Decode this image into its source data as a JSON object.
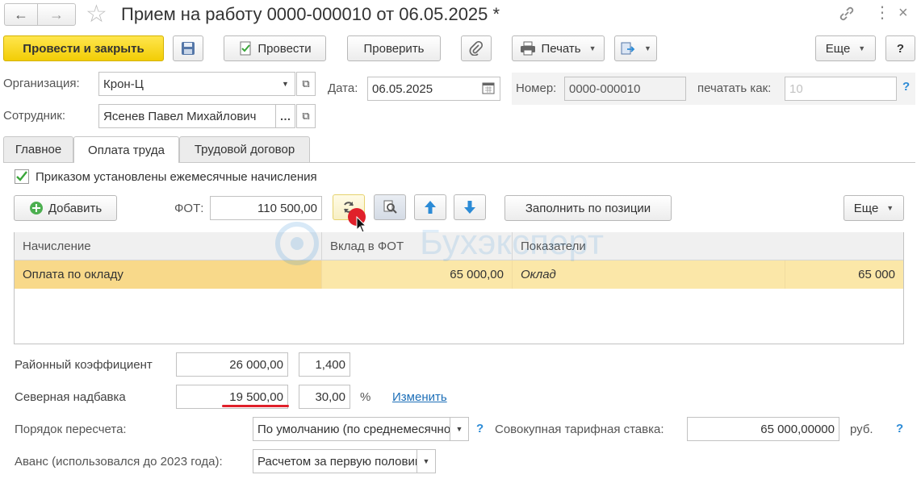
{
  "window": {
    "title": "Прием на работу 0000-000010 от 06.05.2025 *"
  },
  "toolbar": {
    "post_close_label": "Провести и закрыть",
    "post_label": "Провести",
    "check_label": "Проверить",
    "print_label": "Печать",
    "more_label": "Еще",
    "help_label": "?"
  },
  "header": {
    "org_label": "Организация:",
    "org_value": "Крон-Ц",
    "date_label": "Дата:",
    "date_value": "06.05.2025",
    "number_label": "Номер:",
    "number_value": "0000-000010",
    "print_as_label": "печатать как:",
    "print_as_placeholder": "10",
    "employee_label": "Сотрудник:",
    "employee_value": "Ясенев Павел Михайлович",
    "help": "?"
  },
  "tabs": [
    {
      "label": "Главное"
    },
    {
      "label": "Оплата труда"
    },
    {
      "label": "Трудовой договор"
    }
  ],
  "pay": {
    "monthly_checkbox_label": "Приказом установлены ежемесячные начисления",
    "add_label": "Добавить",
    "fot_label": "ФОТ:",
    "fot_value": "110 500,00",
    "fill_by_position_label": "Заполнить по позиции",
    "more_label": "Еще"
  },
  "grid": {
    "columns": [
      "Начисление",
      "Вклад в ФОТ",
      "Показатели"
    ],
    "rows": [
      {
        "accrual": "Оплата по окладу",
        "contribution": "65 000,00",
        "indicator": "Оклад",
        "indicator_value": "65 000"
      }
    ]
  },
  "watermark": "Бухэксперт",
  "footer": {
    "regional_label": "Районный коэффициент",
    "regional_amount": "26 000,00",
    "regional_coef": "1,400",
    "north_label": "Северная надбавка",
    "north_amount": "19 500,00",
    "north_percent": "30,00",
    "percent_sign": "%",
    "change_link": "Изменить",
    "recalc_label": "Порядок пересчета:",
    "recalc_value": "По умолчанию (по среднемесячному)",
    "tariff_label": "Совокупная тарифная ставка:",
    "tariff_value": "65 000,00000",
    "currency": "руб.",
    "advance_label": "Аванс (использовался до 2023 года):",
    "advance_value": "Расчетом за первую половину месяца",
    "help": "?"
  },
  "colors": {
    "accent_yellow": "#f2cd05",
    "row_highlight": "#fbe7a8",
    "link_blue": "#1d6fb8",
    "underline_red": "#e0202a",
    "checkbox_green": "#3aa63a"
  }
}
